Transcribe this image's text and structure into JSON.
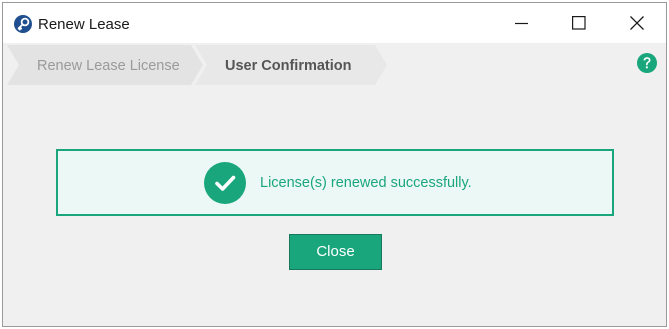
{
  "window": {
    "title": "Renew Lease",
    "app_icon": "key-icon",
    "controls": [
      "minimize-icon",
      "maximize-icon",
      "close-icon"
    ]
  },
  "wizard": {
    "steps": [
      {
        "label": "Renew Lease License",
        "state": "completed"
      },
      {
        "label": "User Confirmation",
        "state": "active"
      }
    ],
    "help_icon": "question-icon"
  },
  "message": {
    "icon": "checkmark-icon",
    "text": "License(s) renewed successfully."
  },
  "actions": {
    "close_label": "Close"
  },
  "colors": {
    "accent": "#1aa67c",
    "message_background": "#ecf8f5",
    "help": "#1aa67c",
    "app_icon": "#1f4f8f"
  }
}
